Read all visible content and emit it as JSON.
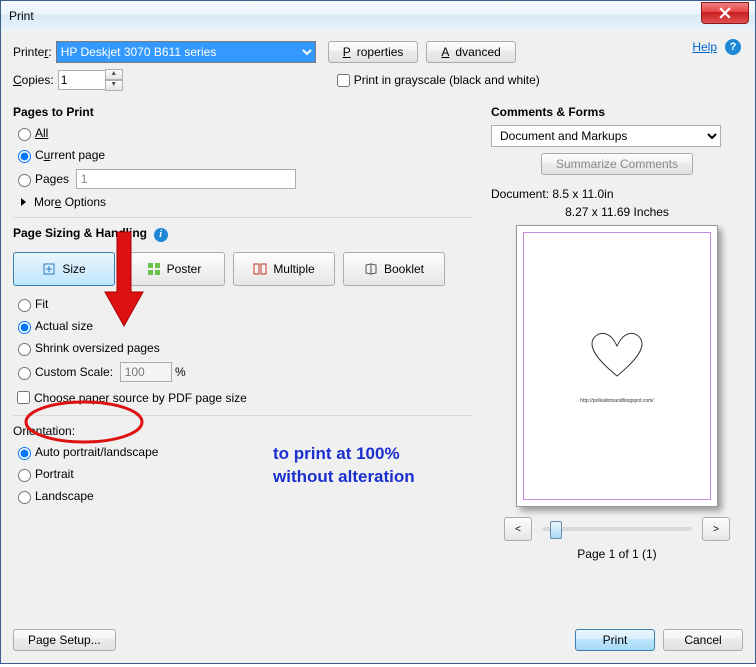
{
  "window": {
    "title": "Print"
  },
  "help": {
    "label": "Help"
  },
  "printer": {
    "label": "Printer:",
    "selected": "HP Deskjet 3070 B611 series",
    "properties_btn": "Properties",
    "advanced_btn": "Advanced"
  },
  "copies": {
    "label": "Copies:",
    "value": "1"
  },
  "grayscale": {
    "label": "Print in grayscale (black and white)"
  },
  "pages_to_print": {
    "title": "Pages to Print",
    "all": "All",
    "current": "Current page",
    "pages": "Pages",
    "pages_value": "1",
    "more": "More Options"
  },
  "sizing": {
    "title": "Page Sizing & Handling",
    "tabs": {
      "size": "Size",
      "poster": "Poster",
      "multiple": "Multiple",
      "booklet": "Booklet"
    },
    "fit": "Fit",
    "actual": "Actual size",
    "shrink": "Shrink oversized pages",
    "custom": "Custom Scale:",
    "custom_value": "100",
    "custom_unit": "%",
    "paper_source": "Choose paper source by PDF page size"
  },
  "orientation": {
    "title": "Orientation:",
    "auto": "Auto portrait/landscape",
    "portrait": "Portrait",
    "landscape": "Landscape"
  },
  "comments": {
    "title": "Comments & Forms",
    "selected": "Document and Markups",
    "summarize": "Summarize Comments"
  },
  "preview": {
    "doc_label": "Document: 8.5 x 11.0in",
    "scale_label": "8.27 x 11.69 Inches",
    "caption": "http://polkadotsandblogspot.com/",
    "page_label": "Page 1 of 1 (1)",
    "prev": "<",
    "next": ">"
  },
  "footer": {
    "page_setup": "Page Setup...",
    "print": "Print",
    "cancel": "Cancel"
  },
  "annotation": {
    "line1": "to print at 100%",
    "line2": "without alteration"
  }
}
